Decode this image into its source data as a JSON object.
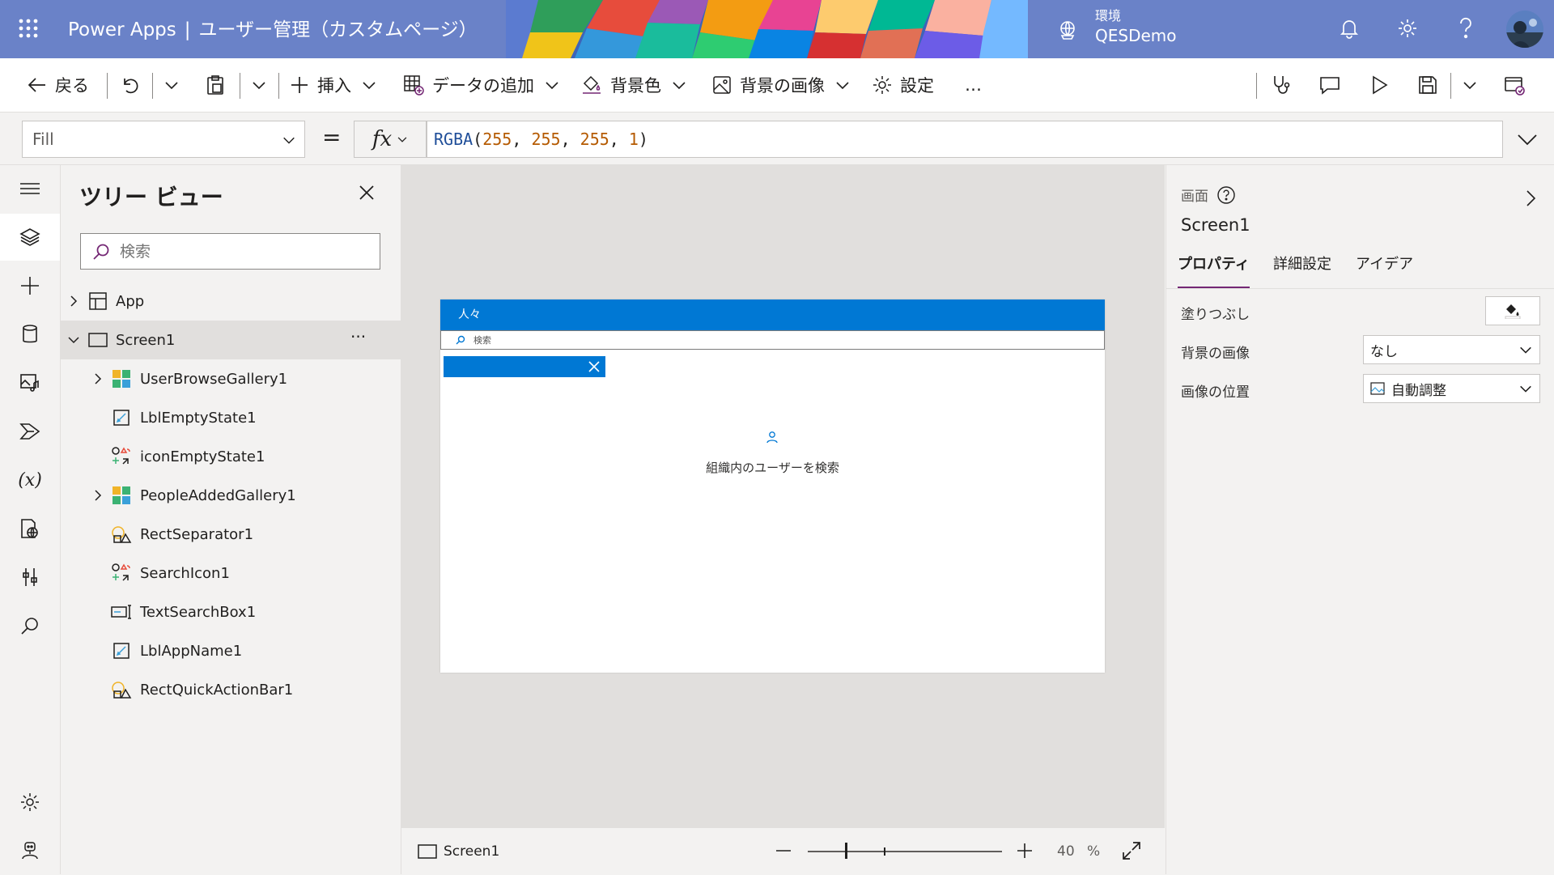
{
  "header": {
    "app_name": "Power Apps",
    "separator": "|",
    "page_title": "ユーザー管理（カスタムページ）",
    "env_label": "環境",
    "env_name": "QESDemo"
  },
  "commands": {
    "back": "戻る",
    "insert": "挿入",
    "add_data": "データの追加",
    "bg_color": "背景色",
    "bg_image": "背景の画像",
    "settings": "設定",
    "more": "…"
  },
  "formula_bar": {
    "property": "Fill",
    "equals": "=",
    "fx": "fx",
    "formula_fn": "RGBA",
    "formula_args": [
      "255",
      "255",
      "255",
      "1"
    ]
  },
  "tree_view": {
    "title": "ツリー ビュー",
    "search_placeholder": "検索",
    "nodes": [
      {
        "label": "App"
      },
      {
        "label": "Screen1",
        "more": "···"
      },
      {
        "label": "UserBrowseGallery1"
      },
      {
        "label": "LblEmptyState1"
      },
      {
        "label": "iconEmptyState1"
      },
      {
        "label": "PeopleAddedGallery1"
      },
      {
        "label": "RectSeparator1"
      },
      {
        "label": "SearchIcon1"
      },
      {
        "label": "TextSearchBox1"
      },
      {
        "label": "LblAppName1"
      },
      {
        "label": "RectQuickActionBar1"
      }
    ]
  },
  "canvas": {
    "app_header": "人々",
    "search_placeholder": "検索",
    "empty_state_text": "組織内のユーザーを検索"
  },
  "status_bar": {
    "screen_name": "Screen1",
    "zoom_value": "40",
    "zoom_unit": "%",
    "zoom_fraction": 0.4
  },
  "properties_panel": {
    "kind": "画面",
    "name": "Screen1",
    "tabs": [
      "プロパティ",
      "詳細設定",
      "アイデア"
    ],
    "fill_label": "塗りつぶし",
    "bg_image_label": "背景の画像",
    "bg_image_value": "なし",
    "image_position_label": "画像の位置",
    "image_position_value": "自動調整"
  },
  "colors": {
    "header_bg": "#6a82c8",
    "accent_blue": "#0078d4",
    "tab_underline": "#742774"
  }
}
